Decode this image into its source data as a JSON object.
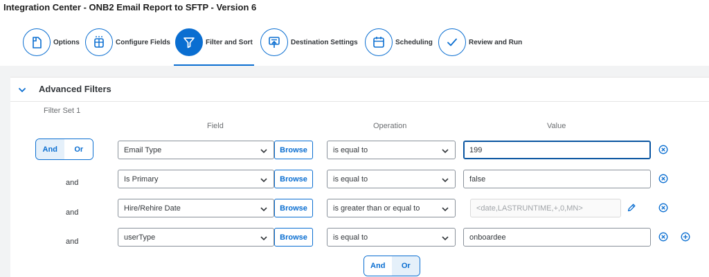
{
  "header": {
    "title": "Integration Center - ONB2 Email Report to SFTP - Version 6"
  },
  "steps": [
    {
      "label": "Options",
      "icon": "document-icon"
    },
    {
      "label": "Configure Fields",
      "icon": "table-columns-icon"
    },
    {
      "label": "Filter and Sort",
      "icon": "filter-icon",
      "active": true
    },
    {
      "label": "Destination Settings",
      "icon": "upload-destination-icon"
    },
    {
      "label": "Scheduling",
      "icon": "calendar-icon"
    },
    {
      "label": "Review and Run",
      "icon": "checkmark-icon"
    }
  ],
  "panel": {
    "title": "Advanced Filters",
    "filter_set_label": "Filter Set 1",
    "columns": {
      "field": "Field",
      "operation": "Operation",
      "value": "Value"
    },
    "top_toggle": {
      "and": "And",
      "or": "Or",
      "selected": "And"
    },
    "bottom_toggle": {
      "and": "And",
      "or": "Or",
      "selected": "Or"
    },
    "browse_label": "Browse",
    "rows": [
      {
        "conjunction": "",
        "field": "Email Type",
        "operation": "is equal to",
        "value": "199"
      },
      {
        "conjunction": "and",
        "field": "Is Primary",
        "operation": "is equal to",
        "value": "false"
      },
      {
        "conjunction": "and",
        "field": "Hire/Rehire Date",
        "operation": "is greater than or equal to",
        "value_placeholder": "<date,LASTRUNTIME,+,0,MN>"
      },
      {
        "conjunction": "and",
        "field": "userType",
        "operation": "is equal to",
        "value": "onboardee"
      }
    ]
  },
  "colors": {
    "accent": "#0a6ed1",
    "background": "#f2f3f4"
  }
}
